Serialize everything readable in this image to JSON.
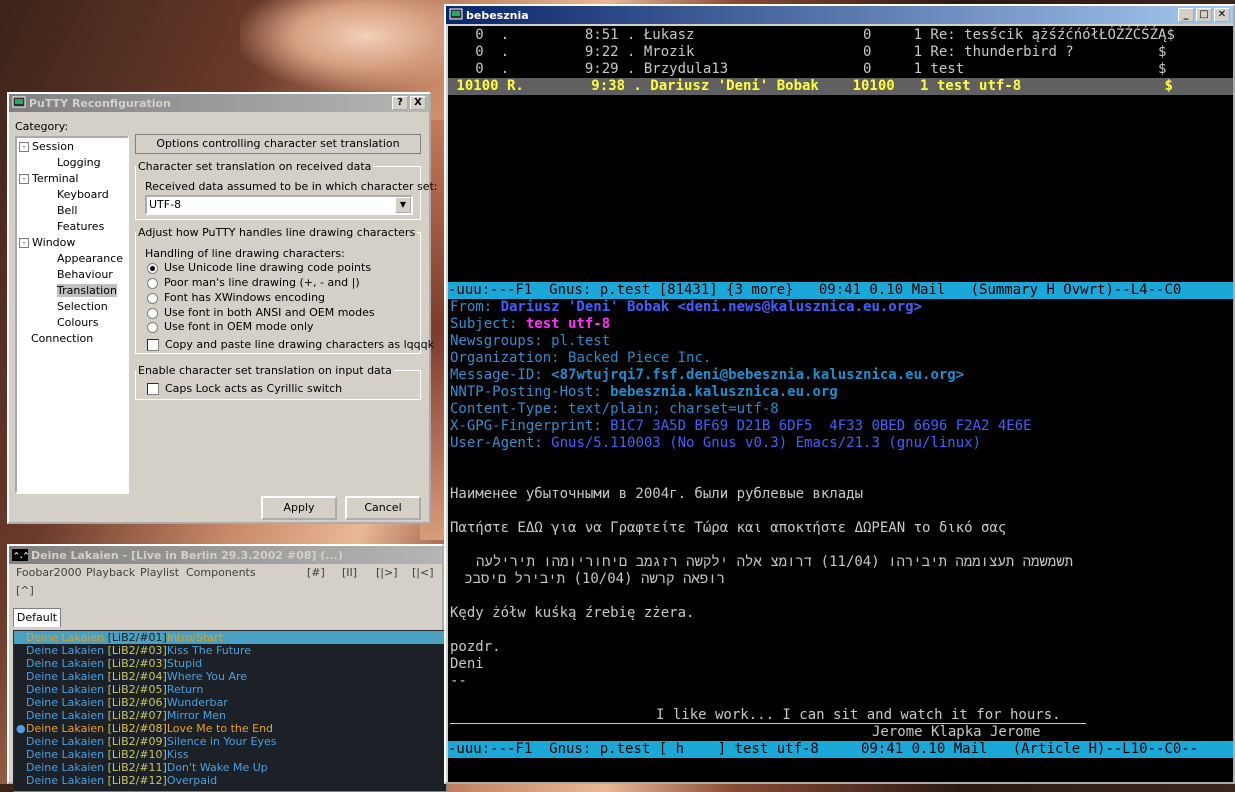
{
  "desktop": {
    "name": "desktop-wallpaper"
  },
  "putty": {
    "title": "PuTTY Reconfiguration",
    "help_btn": "?",
    "close_btn": "X",
    "category_label": "Category:",
    "tree": [
      {
        "label": "Session",
        "expander": "-"
      },
      {
        "label": "Logging"
      },
      {
        "label": "Terminal",
        "expander": "-"
      },
      {
        "label": "Keyboard"
      },
      {
        "label": "Bell"
      },
      {
        "label": "Features"
      },
      {
        "label": "Window",
        "expander": "-"
      },
      {
        "label": "Appearance"
      },
      {
        "label": "Behaviour"
      },
      {
        "label": "Translation",
        "selected": true
      },
      {
        "label": "Selection"
      },
      {
        "label": "Colours"
      },
      {
        "label": "Connection"
      }
    ],
    "header_button": "Options controlling character set translation",
    "received_group": "Character set translation on received data",
    "received_label": "Received data assumed to be in which character set:",
    "received_value": "UTF-8",
    "line_group": "Adjust how PuTTY handles line drawing characters",
    "line_label": "Handling of line drawing characters:",
    "radios": [
      {
        "label": "Use Unicode line drawing code points",
        "checked": true
      },
      {
        "label": "Poor man's line drawing (+, - and |)",
        "checked": false
      },
      {
        "label": "Font has XWindows encoding",
        "checked": false
      },
      {
        "label": "Use font in both ANSI and OEM modes",
        "checked": false
      },
      {
        "label": "Use font in OEM mode only",
        "checked": false
      }
    ],
    "copy_paste_label": "Copy and paste line drawing characters as lqqqk",
    "input_group": "Enable character set translation on input data",
    "capslock_label": "Caps Lock acts as Cyrillic switch",
    "apply": "Apply",
    "cancel": "Cancel"
  },
  "foobar": {
    "title": "Deine Lakaien - [Live in Berlin 29.3.2002 #08] (...)",
    "menu": [
      "Foobar2000",
      "Playback",
      "Playlist",
      "Components"
    ],
    "controls": [
      "[#]",
      "[II]",
      "[|>]",
      "[|<]",
      "[^]"
    ],
    "tab": "Default",
    "rows": [
      {
        "artist": "Deine Lakaien ",
        "tag": "[LiB2/#01]",
        "title": "Intro/Start",
        "state": "selected"
      },
      {
        "artist": "Deine Lakaien ",
        "tag": "[LiB2/#03]",
        "title": "Kiss The Future"
      },
      {
        "artist": "Deine Lakaien ",
        "tag": "[LiB2/#03]",
        "title": "Stupid"
      },
      {
        "artist": "Deine Lakaien ",
        "tag": "[LiB2/#04]",
        "title": "Where You Are"
      },
      {
        "artist": "Deine Lakaien ",
        "tag": "[LiB2/#05]",
        "title": "Return"
      },
      {
        "artist": "Deine Lakaien ",
        "tag": "[LiB2/#06]",
        "title": "Wunderbar"
      },
      {
        "artist": "Deine Lakaien ",
        "tag": "[LiB2/#07]",
        "title": "Mirror Men"
      },
      {
        "artist": "Deine Lakaien ",
        "tag": "[LiB2/#08]",
        "title": "Love Me to the End",
        "state": "playing"
      },
      {
        "artist": "Deine Lakaien ",
        "tag": "[LiB2/#09]",
        "title": "Silence in Your Eyes"
      },
      {
        "artist": "Deine Lakaien ",
        "tag": "[LiB2/#10]",
        "title": "Kiss"
      },
      {
        "artist": "Deine Lakaien ",
        "tag": "[LiB2/#11]",
        "title": "Don't Wake Me Up"
      },
      {
        "artist": "Deine Lakaien ",
        "tag": "[LiB2/#12]",
        "title": "Overpaid"
      }
    ]
  },
  "terminal": {
    "title": "bebesznia",
    "summary": [
      {
        "text": "   0  .         8:51 . Łukasz                    0     1 Re: tesścik ążśźćńółŁÓŻŹĆŚŻĄ$"
      },
      {
        "text": "   0  .         9:22 . Mrozik                    0     1 Re: thunderbird ?          $"
      },
      {
        "text": "   0  .         9:29 . Brzydula13                0     1 test                       $"
      }
    ],
    "summary_selected": " 10100 R.        9:38 . Dariusz 'Deni' Bobak    10100   1 test utf-8                 $",
    "modeline_summary": "-uuu:---F1  Gnus: p.test [81431] {3 more}   09:41 0.10 Mail   (Summary H Ovwrt)--L4--C0",
    "headers": [
      {
        "name": "From: ",
        "value": "Dariusz 'Deni' Bobak <deni.news@kalusznica.eu.org>",
        "style": "b"
      },
      {
        "name": "Subject: ",
        "value": "test utf-8",
        "style": "m"
      },
      {
        "name": "Newsgroups: ",
        "value": "pl.test",
        "style": "c"
      },
      {
        "name": "Organization: ",
        "value": "Backed Piece Inc.",
        "style": "c"
      },
      {
        "name": "Message-ID: ",
        "value": "<87wtujrqi7.fsf.deni@bebesznia.kalusznica.eu.org>",
        "style": "cb"
      },
      {
        "name": "NNTP-Posting-Host: ",
        "value": "bebesznia.kalusznica.eu.org",
        "style": "cb"
      },
      {
        "name": "Content-Type: ",
        "value": "text/plain; charset=utf-8",
        "style": "c"
      },
      {
        "name": "X-GPG-Fingerprint: ",
        "value": "B1C7 3A5D BF69 D21B 6DF5  4F33 0BED 6696 F2A2 4E6E",
        "style": "bl"
      },
      {
        "name": "User-Agent: ",
        "value": "Gnus/5.110003 (No Gnus v0.3) Emacs/21.3 (gnu/linux)",
        "style": "bl"
      }
    ],
    "body": {
      "ru": "Наименее убыточными в 2004г. были рублевые вклады",
      "gr": "Πατήστε ΕΔΩ για να Γραφτείτε Τώρα και αποκτήστε ΔΩΡΕΑΝ το δικό σας",
      "he1": "תשמשמה תעצוממה תיבירהו (11/04) דרומצ אלה ילקשה רזגמב םיחוריומהו תירילעה",
      "he2": "רופאה קרשה (10/04) תיבירל םיסבכ",
      "pl": "Kędy żółw kuśką źrebię zżera.",
      "sig1": "pozdr.",
      "sig2": "Deni",
      "sig3": "--",
      "quote": "I like work... I can sit and watch it for hours.",
      "author": "Jerome Klapka Jerome"
    },
    "modeline_article": "-uuu:---F1  Gnus: p.test [ h    ] test utf-8     09:41 0.10 Mail   (Article H)--L10--C0--"
  }
}
